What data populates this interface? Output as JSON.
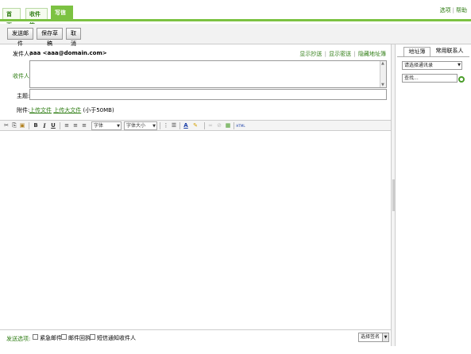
{
  "tabs": [
    {
      "label": "首页"
    },
    {
      "label": "收件箱"
    },
    {
      "label": "写信",
      "close": "☒"
    }
  ],
  "top_links": {
    "options": "选项",
    "separator": "|",
    "help": "帮助"
  },
  "toolbar": {
    "send": "发送邮件",
    "save_draft": "保存草稿",
    "cancel": "取消"
  },
  "sender": {
    "label": "发件人:",
    "value": "aaa <aaa@domain.com>"
  },
  "addr_links": {
    "show_cc": "显示抄送",
    "show_bcc": "显示密送",
    "hide_addressbook": "隐藏地址簿",
    "separator": "|"
  },
  "recipient": {
    "label": "收件人:",
    "value": ""
  },
  "subject": {
    "label": "主题:",
    "value": ""
  },
  "attachment": {
    "label": "附件:",
    "upload": "上传文件",
    "upload_large": "上传大文件",
    "note": "(小于50MB)"
  },
  "editor_toolbar": {
    "font_select": "字体",
    "size_select": "字体大小",
    "icons": [
      "cut-icon",
      "copy-icon",
      "paste-icon",
      "bold-icon",
      "italic-icon",
      "underline-icon",
      "align-left-icon",
      "align-center-icon",
      "align-right-icon",
      "ordered-list-icon",
      "unordered-list-icon",
      "font-color-icon",
      "highlight-icon",
      "link-icon",
      "unlink-icon",
      "image-icon",
      "html-icon"
    ],
    "bold": "B",
    "italic": "I",
    "underline": "U",
    "html": "HTML"
  },
  "send_options": {
    "label": "发送选项:",
    "urgent": "紧急邮件",
    "receipt": "邮件回执",
    "sms_notify": "短信通知收件人",
    "signature": "选择签名"
  },
  "right_panel": {
    "tab_addressbook": "地址簿",
    "tab_frequent": "常用联系人",
    "select_placeholder": "请选择通讯录",
    "search_placeholder": "查找..."
  },
  "colors": {
    "accent": "#7cc242",
    "link": "#2f7d14"
  }
}
